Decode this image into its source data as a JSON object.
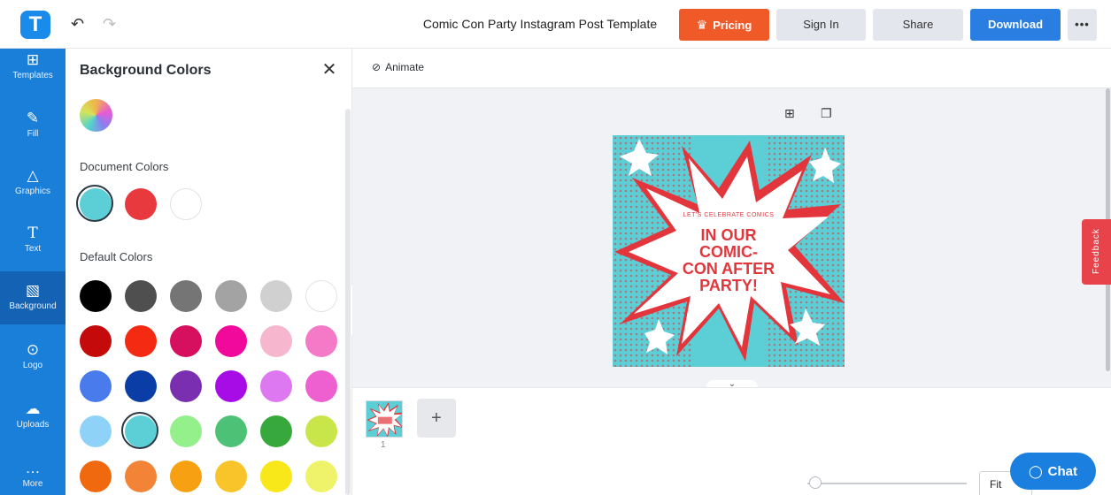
{
  "app": {
    "logo_letter": "T"
  },
  "header": {
    "document_title": "Comic Con Party Instagram Post Template",
    "pricing_label": "Pricing",
    "signin_label": "Sign In",
    "share_label": "Share",
    "download_label": "Download",
    "more_label": "•••"
  },
  "rail": {
    "items": [
      {
        "label": "Templates",
        "icon": "templates-icon"
      },
      {
        "label": "Fill",
        "icon": "brush-icon"
      },
      {
        "label": "Graphics",
        "icon": "shapes-icon"
      },
      {
        "label": "Text",
        "icon": "text-icon"
      },
      {
        "label": "Background",
        "icon": "background-icon",
        "active": true
      },
      {
        "label": "Logo",
        "icon": "logo-icon"
      },
      {
        "label": "Uploads",
        "icon": "cloud-upload-icon"
      },
      {
        "label": "More",
        "icon": "more-icon"
      }
    ]
  },
  "panel": {
    "title": "Background Colors",
    "document_colors_label": "Document Colors",
    "default_colors_label": "Default Colors",
    "document_colors": [
      "#5ccfd6",
      "#e8393f",
      "#ffffff"
    ],
    "selected_document_color": 0,
    "default_colors": [
      [
        "#000000",
        "#4f4f4f",
        "#757575",
        "#a3a3a3",
        "#d0d0d0",
        "#ffffff"
      ],
      [
        "#c40a0a",
        "#f42a12",
        "#d60f5e",
        "#f0099a",
        "#f6b6cd",
        "#f47ac8"
      ],
      [
        "#4a7bed",
        "#0a3ea6",
        "#7a2fb0",
        "#a80ce6",
        "#dd78f0",
        "#ee5fcf"
      ],
      [
        "#8fd2f8",
        "#5ccfd6",
        "#93f08a",
        "#4dc276",
        "#37a93c",
        "#c8e649"
      ],
      [
        "#f0690f",
        "#f28337",
        "#f7a012",
        "#f8c42a",
        "#f8e81a",
        "#eef36a"
      ]
    ],
    "selected_default_color": [
      3,
      1
    ]
  },
  "toolbar": {
    "animate_label": "Animate"
  },
  "design": {
    "small_text": "LET'S CELEBRATE COMICS",
    "headline_lines": [
      "IN OUR",
      "COMIC-",
      "CON AFTER",
      "PARTY!"
    ],
    "colors": {
      "background": "#5ccfd6",
      "burst": "#ffffff",
      "accent": "#e2353c"
    }
  },
  "pages": {
    "thumbnail_number": "1",
    "add_label": "+"
  },
  "feedback_label": "Feedback",
  "zoom": {
    "fit_label": "Fit"
  },
  "chat": {
    "label": "Chat"
  }
}
